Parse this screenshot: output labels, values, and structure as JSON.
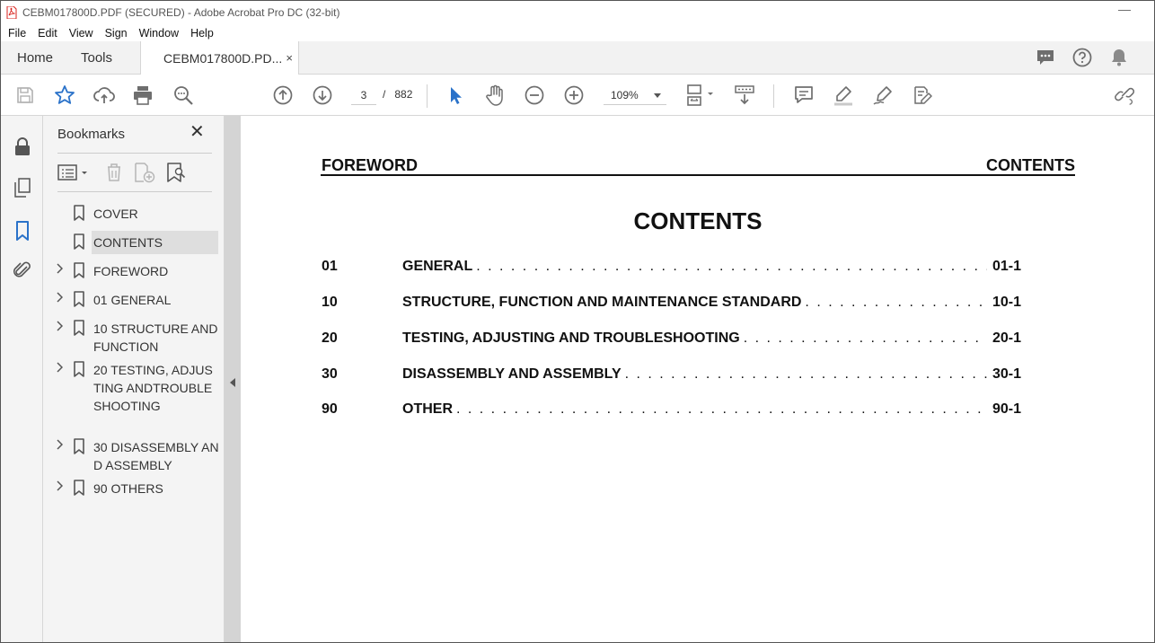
{
  "window": {
    "title": "CEBM017800D.PDF (SECURED) - Adobe Acrobat Pro DC (32-bit)",
    "minimize_glyph": "—"
  },
  "menu": [
    "File",
    "Edit",
    "View",
    "Sign",
    "Window",
    "Help"
  ],
  "tabs": {
    "home": "Home",
    "tools": "Tools",
    "document": "CEBM017800D.PD...",
    "close_glyph": "×"
  },
  "toolbar": {
    "current_page": "3",
    "page_separator": "/",
    "total_pages": "882",
    "zoom": "109%"
  },
  "bookmarks": {
    "title": "Bookmarks",
    "close_glyph": "✕",
    "items": [
      {
        "label": "COVER",
        "expandable": false,
        "selected": false
      },
      {
        "label": "CONTENTS",
        "expandable": false,
        "selected": true
      },
      {
        "label": "FOREWORD",
        "expandable": true,
        "selected": false
      },
      {
        "label": "01 GENERAL",
        "expandable": true,
        "selected": false
      },
      {
        "label": "10 STRUCTURE AND FUNCTION",
        "expandable": true,
        "selected": false
      },
      {
        "label": "20 TESTING, ADJUSTING ANDTROUBLESHOOTING",
        "expandable": true,
        "selected": false
      },
      {
        "label": "30 DISASSEMBLY AND ASSEMBLY",
        "expandable": true,
        "selected": false
      },
      {
        "label": "90 OTHERS",
        "expandable": true,
        "selected": false
      }
    ]
  },
  "document": {
    "header_left": "FOREWORD",
    "header_right": "CONTENTS",
    "title": "CONTENTS",
    "toc": [
      {
        "num": "01",
        "title": "GENERAL",
        "page": "01-1"
      },
      {
        "num": "10",
        "title": "STRUCTURE, FUNCTION AND MAINTENANCE STANDARD",
        "page": "10-1"
      },
      {
        "num": "20",
        "title": "TESTING, ADJUSTING AND TROUBLESHOOTING",
        "page": "20-1"
      },
      {
        "num": "30",
        "title": "DISASSEMBLY AND ASSEMBLY",
        "page": "30-1"
      },
      {
        "num": "90",
        "title": "OTHER",
        "page": "90-1"
      }
    ]
  },
  "colors": {
    "accent_blue": "#2a72c9",
    "pdf_red": "#d9221c",
    "icon_gray": "#6e6e6e"
  }
}
